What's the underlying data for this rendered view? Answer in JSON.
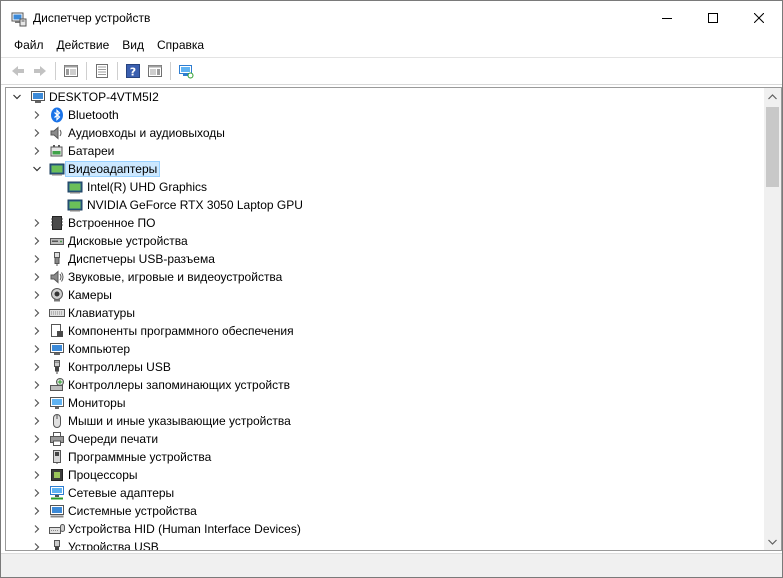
{
  "window": {
    "title": "Диспетчер устройств",
    "icon": "device-manager-icon"
  },
  "menu": {
    "items": [
      "Файл",
      "Действие",
      "Вид",
      "Справка"
    ]
  },
  "toolbar": {
    "buttons": [
      {
        "name": "back-arrow-icon",
        "enabled": false
      },
      {
        "name": "forward-arrow-icon",
        "enabled": false
      },
      {
        "name": "show-hide-console-tree-icon",
        "enabled": true
      },
      {
        "name": "properties-icon",
        "enabled": true
      },
      {
        "name": "help-icon",
        "enabled": true
      },
      {
        "name": "show-action-pane-icon",
        "enabled": true
      },
      {
        "name": "scan-hardware-icon",
        "enabled": true
      }
    ]
  },
  "tree": {
    "root": {
      "label": "DESKTOP-4VTM5I2",
      "icon": "computer-icon",
      "expanded": true
    },
    "categories": [
      {
        "label": "Bluetooth",
        "icon": "bluetooth-icon",
        "expanded": false
      },
      {
        "label": "Аудиовходы и аудиовыходы",
        "icon": "speaker-icon",
        "expanded": false
      },
      {
        "label": "Батареи",
        "icon": "battery-icon",
        "expanded": false
      },
      {
        "label": "Видеоадаптеры",
        "icon": "display-adapter-icon",
        "expanded": true,
        "selected": true,
        "children": [
          {
            "label": "Intel(R) UHD Graphics",
            "icon": "display-adapter-icon"
          },
          {
            "label": "NVIDIA GeForce RTX 3050 Laptop GPU",
            "icon": "display-adapter-icon"
          }
        ]
      },
      {
        "label": "Встроенное ПО",
        "icon": "firmware-icon",
        "expanded": false
      },
      {
        "label": "Дисковые устройства",
        "icon": "disk-drive-icon",
        "expanded": false
      },
      {
        "label": "Диспетчеры USB-разъема",
        "icon": "usb-connector-icon",
        "expanded": false
      },
      {
        "label": "Звуковые, игровые и видеоустройства",
        "icon": "sound-icon",
        "expanded": false
      },
      {
        "label": "Камеры",
        "icon": "camera-icon",
        "expanded": false
      },
      {
        "label": "Клавиатуры",
        "icon": "keyboard-icon",
        "expanded": false
      },
      {
        "label": "Компоненты программного обеспечения",
        "icon": "software-component-icon",
        "expanded": false
      },
      {
        "label": "Компьютер",
        "icon": "computer-icon",
        "expanded": false
      },
      {
        "label": "Контроллеры USB",
        "icon": "usb-icon",
        "expanded": false
      },
      {
        "label": "Контроллеры запоминающих устройств",
        "icon": "storage-controller-icon",
        "expanded": false
      },
      {
        "label": "Мониторы",
        "icon": "monitor-icon",
        "expanded": false
      },
      {
        "label": "Мыши и иные указывающие устройства",
        "icon": "mouse-icon",
        "expanded": false
      },
      {
        "label": "Очереди печати",
        "icon": "printer-icon",
        "expanded": false
      },
      {
        "label": "Программные устройства",
        "icon": "software-device-icon",
        "expanded": false
      },
      {
        "label": "Процессоры",
        "icon": "processor-icon",
        "expanded": false
      },
      {
        "label": "Сетевые адаптеры",
        "icon": "network-adapter-icon",
        "expanded": false
      },
      {
        "label": "Системные устройства",
        "icon": "system-device-icon",
        "expanded": false
      },
      {
        "label": "Устройства HID (Human Interface Devices)",
        "icon": "hid-icon",
        "expanded": false
      },
      {
        "label": "Устройства USB",
        "icon": "usb-icon",
        "expanded": false
      }
    ]
  },
  "scrollbar": {
    "position": 0.0
  },
  "colors": {
    "selection": "#cce8ff",
    "accent": "#0078d7"
  }
}
